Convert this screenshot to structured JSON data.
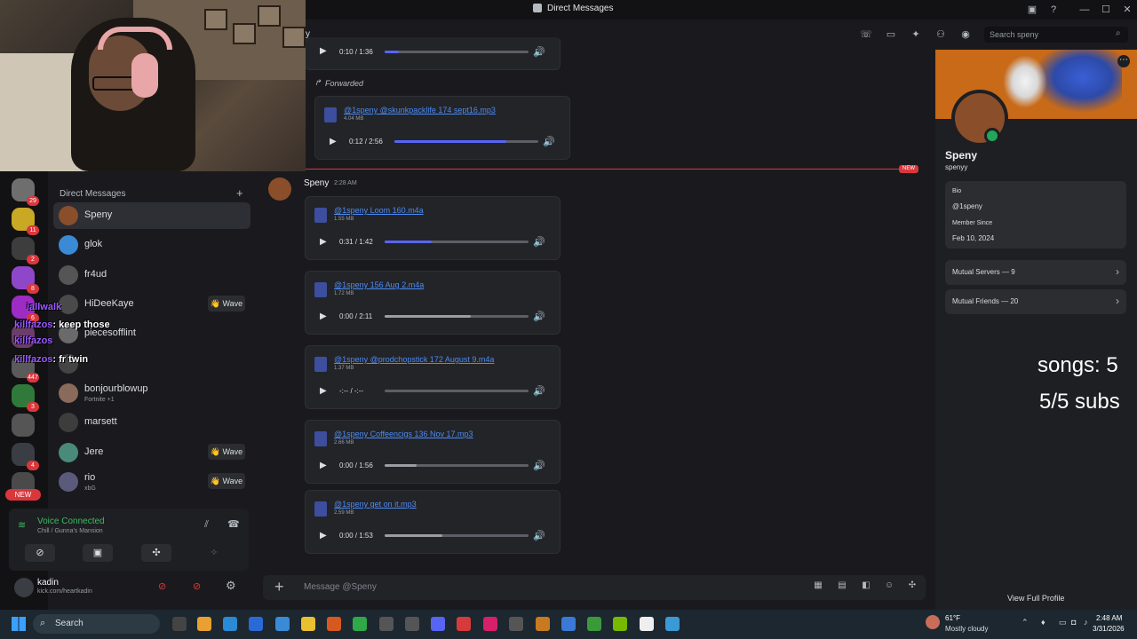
{
  "window": {
    "title": "Direct Messages",
    "header_partial": "y"
  },
  "dm_sidebar": {
    "header": "Direct Messages",
    "items": [
      {
        "name": "Speny",
        "status": "",
        "wave": ""
      },
      {
        "name": "glok",
        "status": "",
        "wave": ""
      },
      {
        "name": "fr4ud",
        "status": "",
        "wave": ""
      },
      {
        "name": "HiDeeKaye",
        "status": "",
        "wave": "Wave"
      },
      {
        "name": "piecesofflint",
        "status": "",
        "wave": ""
      },
      {
        "name": "",
        "status": "",
        "wave": ""
      },
      {
        "name": "bonjourblowup",
        "status": "Fortnite +1",
        "wave": ""
      },
      {
        "name": "marsett",
        "status": "",
        "wave": ""
      },
      {
        "name": "Jere",
        "status": "",
        "wave": "Wave"
      },
      {
        "name": "rio",
        "status": "xbG",
        "wave": "Wave"
      }
    ]
  },
  "server_badges": [
    "29",
    "11",
    "2",
    "8",
    "6",
    "447",
    "3",
    "4"
  ],
  "rail_new": "NEW",
  "stream_chat": [
    {
      "user": "killfazos",
      "text": ": keep those"
    },
    {
      "user": "killfazos",
      "text": ": fr twin"
    },
    {
      "user": "killfazos",
      "text": ""
    },
    {
      "user": "iallwalk",
      "text": ""
    }
  ],
  "voice": {
    "status": "Voice Connected",
    "channel": "Chill / Gunna's Mansion"
  },
  "user": {
    "name": "kadin",
    "status": "kick.com/heartkadin"
  },
  "messages": {
    "forwarded_label": "Forwarded",
    "new_label": "NEW",
    "author": "Speny",
    "time": "2:28 AM",
    "top_player": {
      "time": "0:10 / 1:36",
      "progress": 0.1
    },
    "forwarded_file": {
      "name": "@1speny @skunkpacklife 174 sept16.mp3",
      "size": "4.04 MB",
      "time": "0:12 / 2:56",
      "progress": 0.78
    },
    "files": [
      {
        "name": "@1speny Loom 160.m4a",
        "size": "1.55 MB",
        "time": "0:31 / 1:42",
        "progress": 0.33
      },
      {
        "name": "@1speny 156 Aug 2.m4a",
        "size": "1.72 MB",
        "time": "0:00 / 2:11",
        "progress": 0.6
      },
      {
        "name": "@1speny @prodchopstick 172 August 9.m4a",
        "size": "1.37 MB",
        "time": "-:-- / -:--",
        "progress": 0.0
      },
      {
        "name": "@1speny Coffeencigs 136 Nov 17.mp3",
        "size": "2.66 MB",
        "time": "0:00 / 1:56",
        "progress": 0.22
      },
      {
        "name": "@1speny get on it.mp3",
        "size": "2.59 MB",
        "time": "0:00 / 1:53",
        "progress": 0.4
      }
    ]
  },
  "composer": {
    "placeholder": "Message @Speny"
  },
  "search": {
    "placeholder": "Search speny"
  },
  "profile": {
    "display_name": "Speny",
    "username": "spenyy",
    "bio_label": "Bio",
    "bio": "@1speny",
    "member_since_label": "Member Since",
    "member_since": "Feb 10, 2024",
    "mutual_servers": "Mutual Servers — 9",
    "mutual_friends": "Mutual Friends — 20",
    "view_full": "View Full Profile"
  },
  "overlay": {
    "songs": "songs: 5",
    "subs": "5/5 subs"
  },
  "taskbar": {
    "search": "Search",
    "weather_temp": "61°F",
    "weather_desc": "Mostly cloudy",
    "time": "2:48 AM",
    "date": "3/31/2026"
  },
  "colors": {
    "accent": "#5865f2",
    "new": "#da373c",
    "link": "#4c8bf5",
    "online": "#23a55a"
  }
}
